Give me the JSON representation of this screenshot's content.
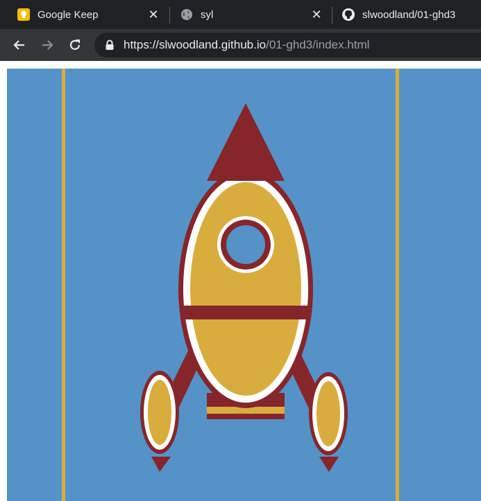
{
  "browser": {
    "tabs": [
      {
        "title": "Google Keep",
        "favicon": "google-keep-icon"
      },
      {
        "title": "syl",
        "favicon": "globe-icon"
      },
      {
        "title": "slwoodland/01-ghd3",
        "favicon": "github-icon"
      }
    ],
    "url_host": "https://slwoodland.github.io",
    "url_path": "/01-ghd3/index.html"
  },
  "colors": {
    "chrome_dark": "#202124",
    "chrome_mid": "#35363a",
    "sky": "#5592c8",
    "gold": "#d8ad3e",
    "maroon": "#86262b",
    "white": "#ffffff"
  }
}
